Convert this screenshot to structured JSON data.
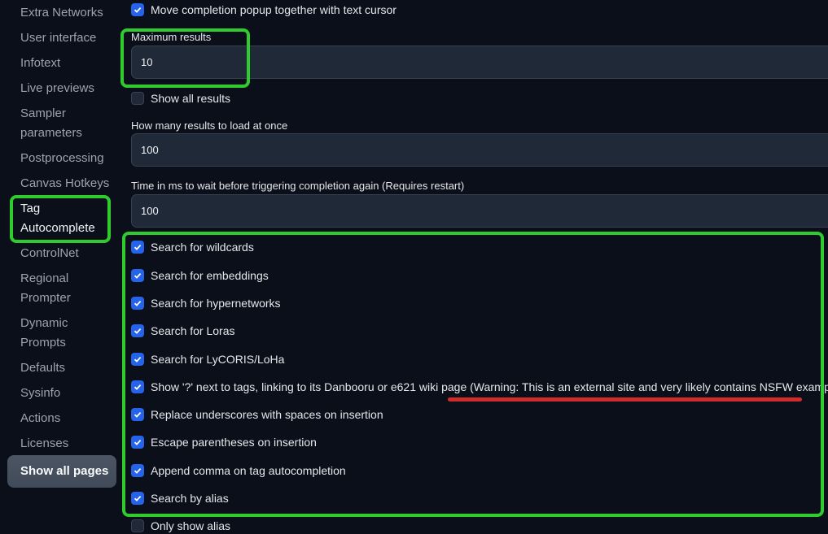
{
  "sidebar": {
    "items": [
      {
        "label": "Extra Networks"
      },
      {
        "label": "User interface"
      },
      {
        "label": "Infotext"
      },
      {
        "label": "Live previews"
      },
      {
        "label": "Sampler parameters"
      },
      {
        "label": "Postprocessing"
      },
      {
        "label": "Canvas Hotkeys"
      },
      {
        "label": "Tag Autocomplete",
        "active": true
      },
      {
        "label": "ControlNet"
      },
      {
        "label": "Regional Prompter"
      },
      {
        "label": "Dynamic Prompts"
      },
      {
        "label": "Defaults"
      },
      {
        "label": "Sysinfo"
      },
      {
        "label": "Actions"
      },
      {
        "label": "Licenses"
      }
    ],
    "show_all_label": "Show all pages"
  },
  "settings": {
    "move_popup": {
      "label": "Move completion popup together with text cursor",
      "checked": true
    },
    "max_results": {
      "label": "Maximum results",
      "value": "10"
    },
    "show_all_results": {
      "label": "Show all results",
      "checked": false
    },
    "results_at_once": {
      "label": "How many results to load at once",
      "value": "100"
    },
    "delay_time": {
      "label": "Time in ms to wait before triggering completion again (Requires restart)",
      "value": "100"
    },
    "checkboxes": [
      {
        "label": "Search for wildcards",
        "checked": true
      },
      {
        "label": "Search for embeddings",
        "checked": true
      },
      {
        "label": "Search for hypernetworks",
        "checked": true
      },
      {
        "label": "Search for Loras",
        "checked": true
      },
      {
        "label": "Search for LyCORIS/LoHa",
        "checked": true
      },
      {
        "label": "Show '?' next to tags, linking to its Danbooru or e621 wiki page (Warning: This is an external site and very likely contains NSFW examples!)",
        "checked": true
      },
      {
        "label": "Replace underscores with spaces on insertion",
        "checked": true
      },
      {
        "label": "Escape parentheses on insertion",
        "checked": true
      },
      {
        "label": "Append comma on tag autocompletion",
        "checked": true
      },
      {
        "label": "Search by alias",
        "checked": true
      }
    ],
    "only_show_alias": {
      "label": "Only show alias",
      "checked": false
    }
  },
  "annotations": {
    "highlight_color": "#2ecc2e",
    "underline_color": "#d22b2b"
  }
}
